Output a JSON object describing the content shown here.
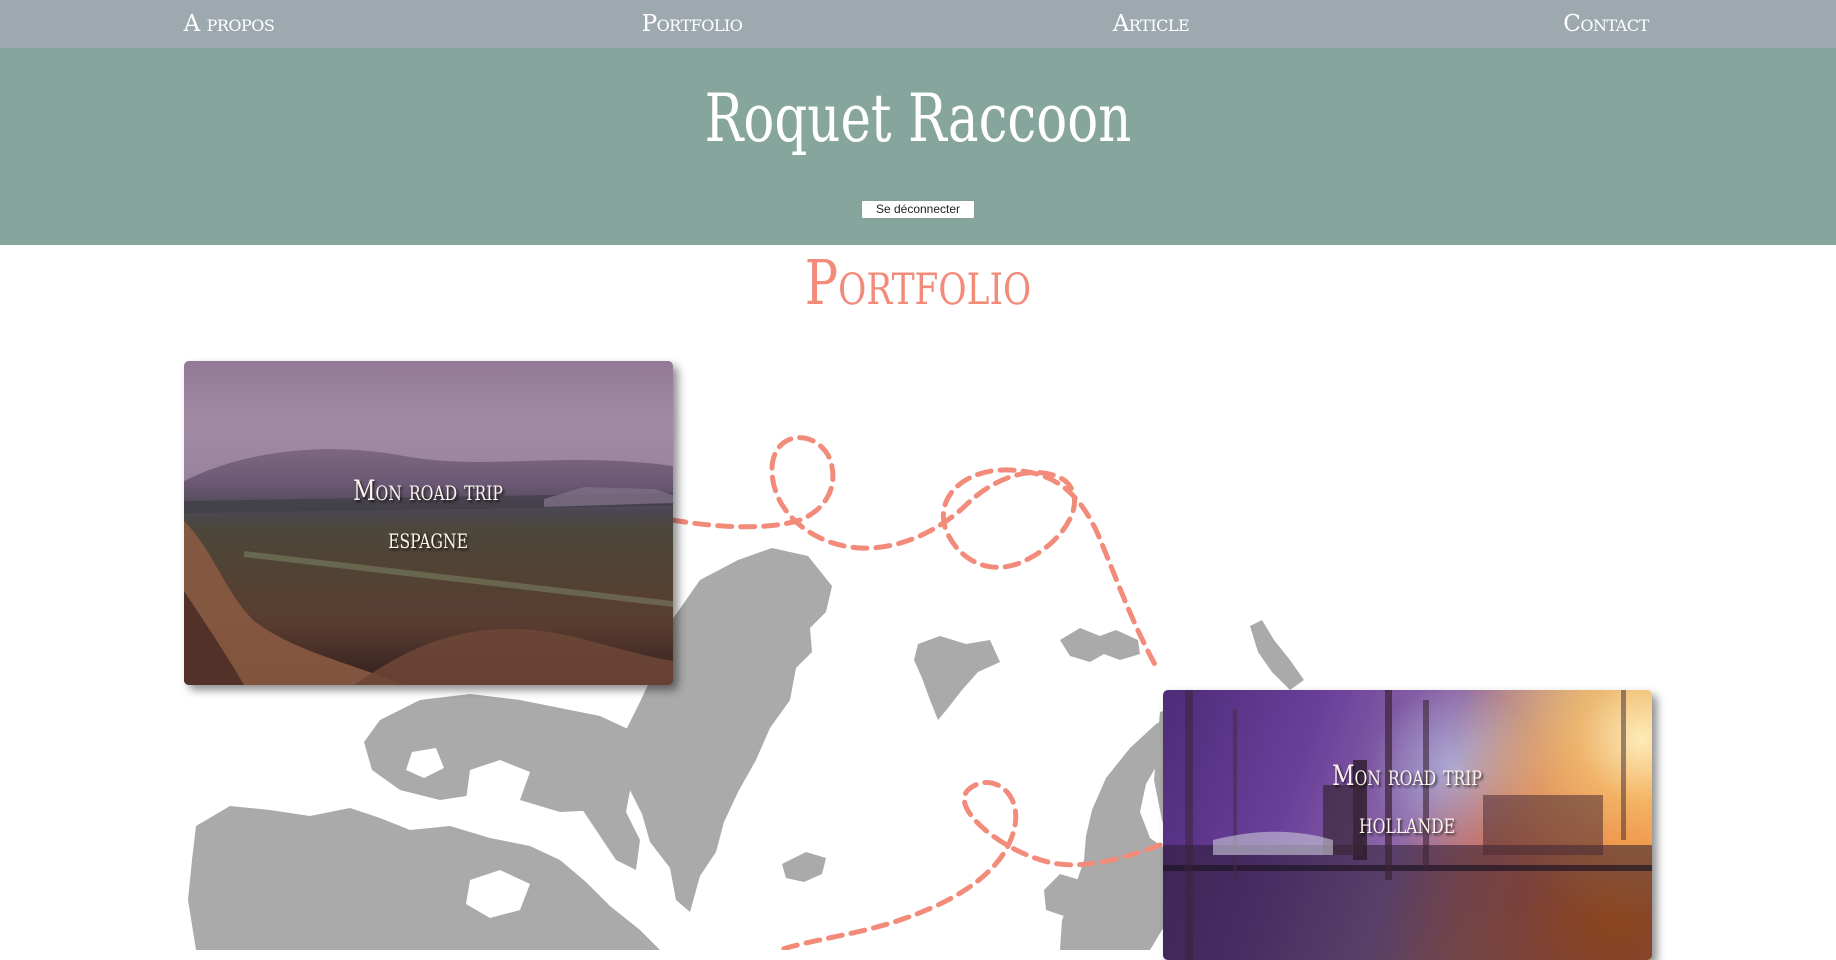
{
  "nav": {
    "items": [
      {
        "label": "A propos"
      },
      {
        "label": "Portfolio"
      },
      {
        "label": "Article"
      },
      {
        "label": "Contact"
      }
    ]
  },
  "header": {
    "title": "Roquet Raccoon",
    "logout_label": "Se déconnecter"
  },
  "portfolio": {
    "title": "Portfolio",
    "cards": [
      {
        "line1": "Mon road trip",
        "line2": "espagne"
      },
      {
        "line1": "Mon road trip",
        "line2": "hollande"
      }
    ]
  },
  "colors": {
    "nav_bg": "#9ea9af",
    "header_bg": "#86a59c",
    "accent": "#f28b7a",
    "map_land": "#aaaaaa"
  }
}
